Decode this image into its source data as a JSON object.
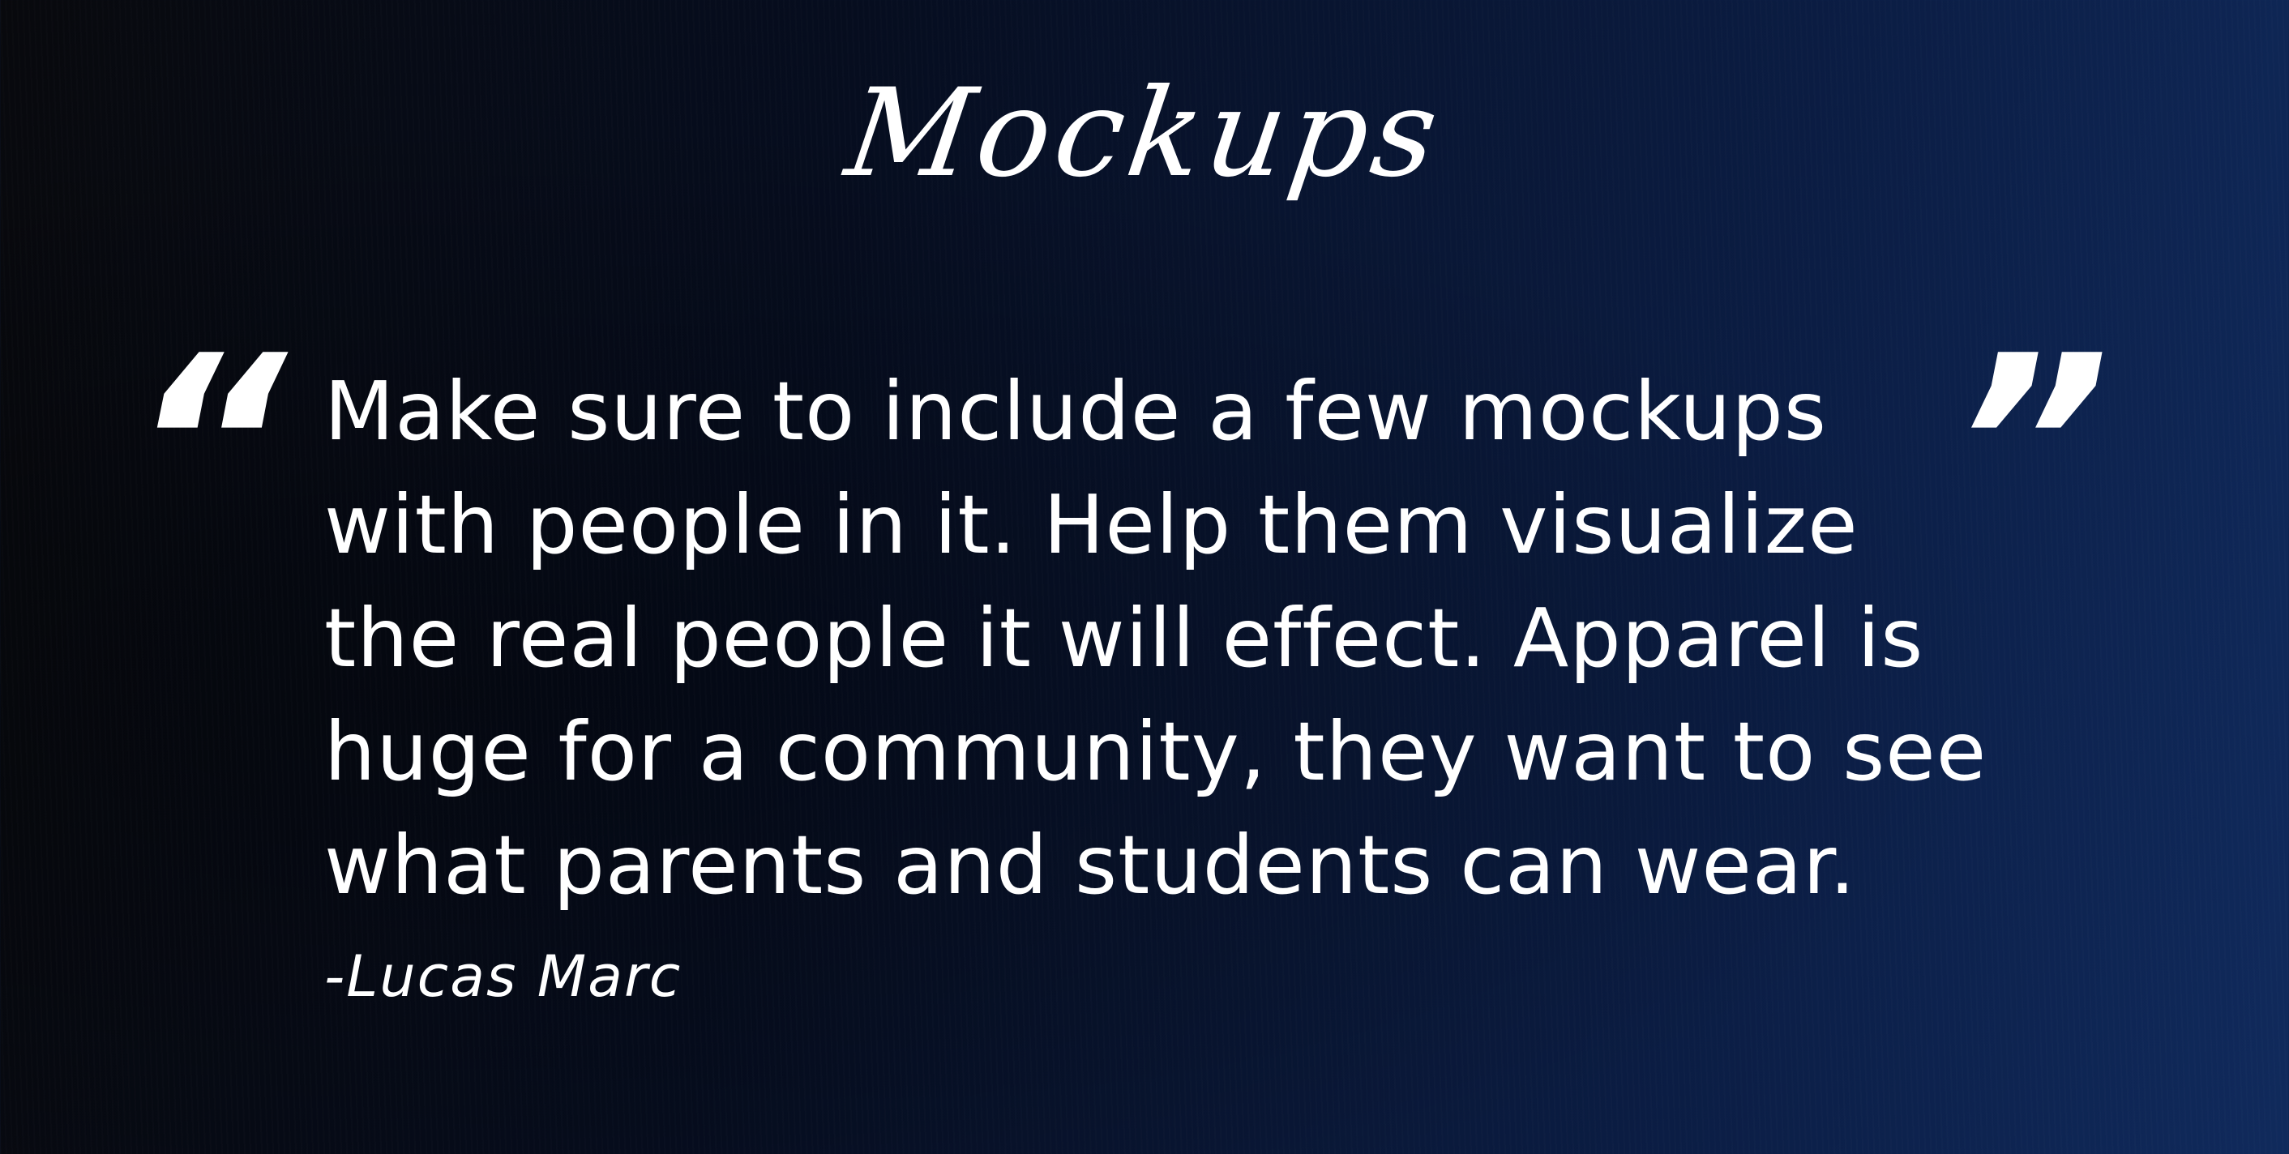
{
  "title": "Mockups",
  "quote": {
    "open_mark": "“",
    "close_mark": "”",
    "lines": [
      "Make sure to include a few mockups",
      "with people in it. Help them visualize",
      "the real people it will effect. Apparel is",
      "huge for a community, they want to see",
      "what parents and students can wear."
    ],
    "author": "-Lucas Marc"
  },
  "colors": {
    "background_left": "#08090d",
    "background_right": "#102a5c",
    "text": "#ffffff"
  }
}
